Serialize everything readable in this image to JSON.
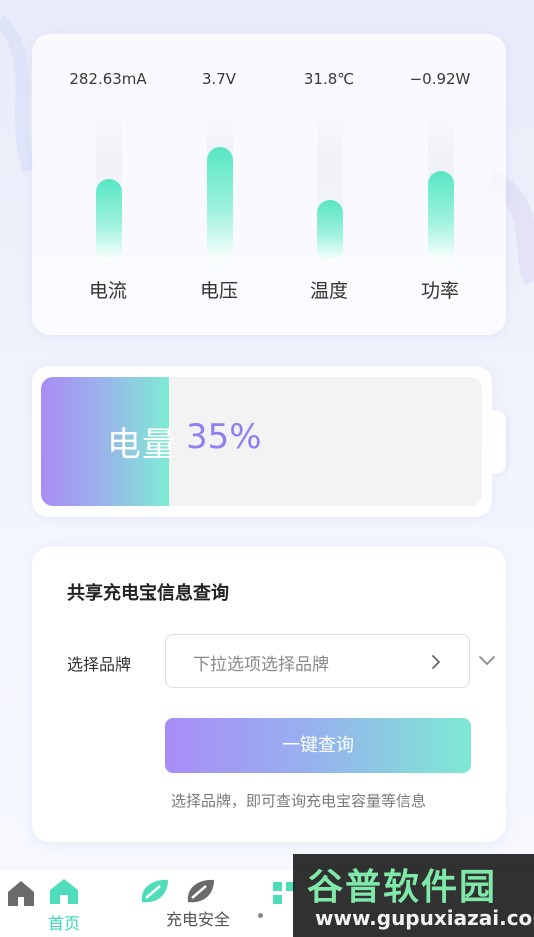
{
  "metrics": [
    {
      "value": "282.63mA",
      "label": "电流",
      "level": 0.54
    },
    {
      "value": "3.7V",
      "label": "电压",
      "level": 0.75
    },
    {
      "value": "31.8℃",
      "label": "温度",
      "level": 0.4
    },
    {
      "value": "−0.92W",
      "label": "功率",
      "level": 0.59
    }
  ],
  "battery": {
    "label": "电量",
    "percent_text": "35%",
    "level": 0.29
  },
  "query": {
    "title": "共享充电宝信息查询",
    "brand_label": "选择品牌",
    "brand_placeholder": "下拉选项选择品牌",
    "button_label": "一键查询",
    "hint": "选择品牌，即可查询充电宝容量等信息"
  },
  "tabbar": {
    "tabs": [
      {
        "label": "首页",
        "icon": "home-icon",
        "active": true
      },
      {
        "label": "充电安全",
        "icon": "leaf-icon",
        "active": false
      }
    ]
  },
  "watermark": {
    "title": "谷普软件园",
    "url": "www.gupuxiazai.com"
  },
  "colors": {
    "accent_purple": "#8f7ff0",
    "accent_teal": "#57e6c4",
    "active_tab": "#36d9b4"
  }
}
